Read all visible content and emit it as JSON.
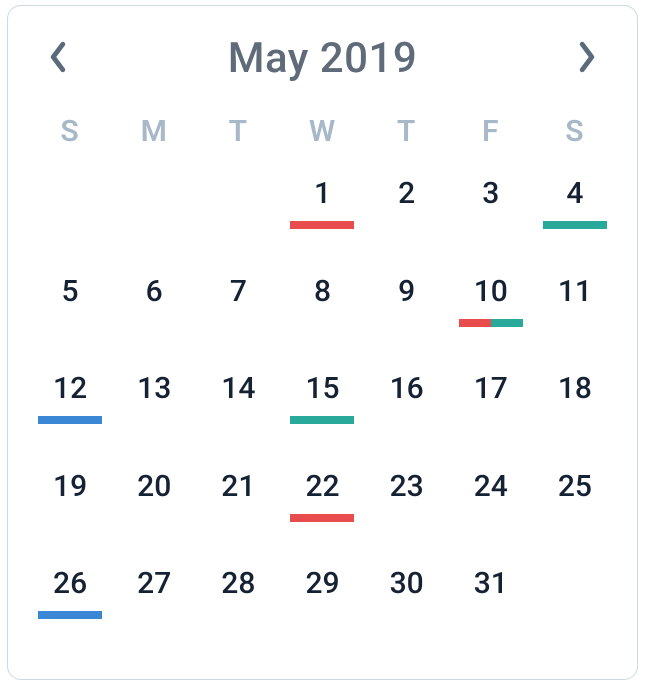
{
  "colors": {
    "red": "#e84c4c",
    "teal": "#28a999",
    "blue": "#3a87d6"
  },
  "header": {
    "title": "May 2019"
  },
  "daysOfWeek": [
    "S",
    "M",
    "T",
    "W",
    "T",
    "F",
    "S"
  ],
  "weeks": [
    [
      {
        "day": null
      },
      {
        "day": null
      },
      {
        "day": null
      },
      {
        "day": 1,
        "marks": [
          "red"
        ]
      },
      {
        "day": 2
      },
      {
        "day": 3
      },
      {
        "day": 4,
        "marks": [
          "teal"
        ]
      }
    ],
    [
      {
        "day": 5
      },
      {
        "day": 6
      },
      {
        "day": 7
      },
      {
        "day": 8
      },
      {
        "day": 9
      },
      {
        "day": 10,
        "marks": [
          "red",
          "teal"
        ]
      },
      {
        "day": 11
      }
    ],
    [
      {
        "day": 12,
        "marks": [
          "blue"
        ]
      },
      {
        "day": 13
      },
      {
        "day": 14
      },
      {
        "day": 15,
        "marks": [
          "teal"
        ]
      },
      {
        "day": 16
      },
      {
        "day": 17
      },
      {
        "day": 18
      }
    ],
    [
      {
        "day": 19
      },
      {
        "day": 20
      },
      {
        "day": 21
      },
      {
        "day": 22,
        "marks": [
          "red"
        ]
      },
      {
        "day": 23
      },
      {
        "day": 24
      },
      {
        "day": 25
      }
    ],
    [
      {
        "day": 26,
        "marks": [
          "blue"
        ]
      },
      {
        "day": 27
      },
      {
        "day": 28
      },
      {
        "day": 29
      },
      {
        "day": 30
      },
      {
        "day": 31
      },
      {
        "day": null
      }
    ]
  ]
}
